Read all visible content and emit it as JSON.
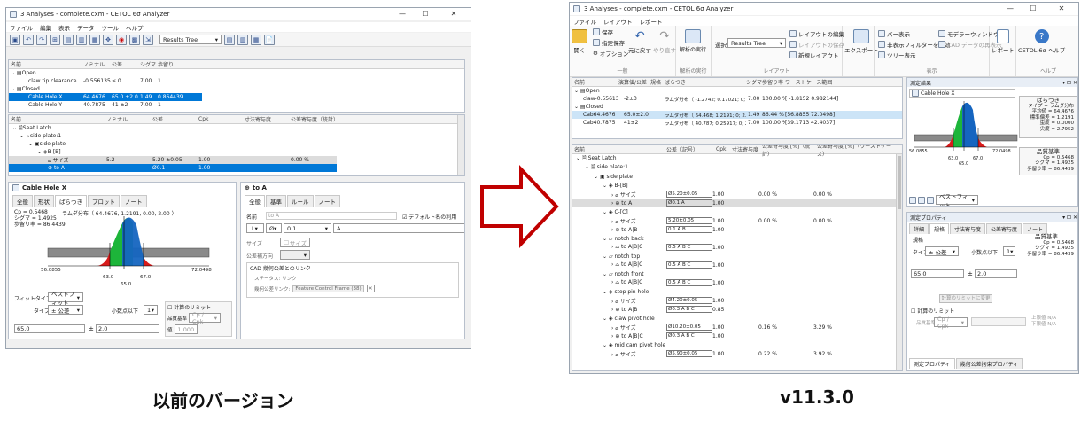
{
  "arrow_color": "#c00000",
  "old": {
    "window_title": "3 Analyses - complete.cxm - CETOL 6σ Analyzer",
    "menu": [
      "ファイル",
      "編集",
      "表示",
      "データ",
      "ツール",
      "ヘルプ"
    ],
    "toolbar_select": "Results Tree",
    "analysis_header": [
      "名前",
      "ノミナル",
      "公差",
      "シグマ",
      "歩留り"
    ],
    "analyses": {
      "open": "Open",
      "open_child": {
        "name": "claw tip clearance",
        "nominal": "-0.556135",
        "tol": "≤ 0",
        "sigma": "7.00",
        "yield": "1"
      },
      "closed": "Closed",
      "rows": [
        {
          "name": "Cable Hole X",
          "nominal": "64.4676",
          "tol": "65.0 ±2.0",
          "sigma": "1.49",
          "yield": "0.864439"
        },
        {
          "name": "Cable Hole Y",
          "nominal": "40.7875",
          "tol": "41 ±2",
          "sigma": "7.00",
          "yield": "1"
        }
      ]
    },
    "tree_header": [
      "名前",
      "ノミナル",
      "公差",
      "Cpk",
      "寸法寄与度",
      "公差寄与度（統計）"
    ],
    "tree": {
      "root": "Seat Latch",
      "n1": "side plate:1",
      "n2": "side plate",
      "n3": "B-[B]",
      "size": {
        "label": "サイズ",
        "nominal": "5.2",
        "tol": "5.20 ±0.05",
        "cpk": "1.00",
        "contrib": "0.00 %"
      },
      "toA": {
        "label": "to A",
        "tol": "Ø0.1",
        "cpk": "1.00"
      }
    },
    "detail_title": "Cable Hole X",
    "detail_tabs": [
      "全般",
      "形状",
      "ばらつき",
      "プロット",
      "ノート"
    ],
    "dist_label": "ラムダ分布（ 64.4676, 1.2191, 0.00, 2.00 ）",
    "stats": [
      "Cp = 0.5468",
      "シグマ = 1.4925",
      "歩留り率 = 86.4439"
    ],
    "axis": {
      "lo": "56.0855",
      "lsl": "63.0",
      "nom": "65.0",
      "usl": "67.0",
      "hi": "72.0498"
    },
    "fit_type_label": "フィットタイプ",
    "fit_type": "ベストフィット",
    "type_label": "タイプ",
    "type_value": "± 公差",
    "decimals_label": "小数点以下",
    "decimals": "1",
    "nominal_value": "65.0",
    "pm": "±",
    "tol_value": "2.0",
    "calc_limit": "計算のリミット",
    "quality_label": "品質基準",
    "quality_value": "Cp / Cpk",
    "value_label": "値",
    "value_value": "1.000",
    "right_title": "to A",
    "right_tabs": [
      "全般",
      "基準",
      "ルール",
      "ノート"
    ],
    "name_label": "名前",
    "name_value": "to A",
    "default_name": "デフォルト名の利用",
    "fcf_value": "0.1",
    "fcf_datum": "A",
    "size_label": "サイズ",
    "size_btn": "サイズ",
    "tol_dir_label": "公差補方向",
    "cad_group": "CAD 幾何公差とのリンク",
    "status": "ステータス: リンク",
    "geo_link_label": "幾何公差リンク:",
    "geo_link_value": "Feature Control Frame (38)"
  },
  "new": {
    "window_title": "3 Analyses - complete.cxm - CETOL 6σ Analyzer",
    "menu": [
      "ファイル",
      "レイアウト",
      "レポート"
    ],
    "ribbon": {
      "open": "開く",
      "save": "保存",
      "save_as": "指定保存",
      "options": "オプション",
      "undo": "元に戻す",
      "redo": "やり直す",
      "general": "一般",
      "run": "解析の実行",
      "run_group": "解析の実行",
      "select_label": "選択",
      "select_value": "Results Tree",
      "layout_edit": "レイアウトの編集",
      "layout_save": "レイアウトの保存",
      "layout_new": "新規レイアウト",
      "layout_group": "レイアウト",
      "export": "エクスポート",
      "bar_show": "バー表示",
      "hide_filter": "非表示フィルターを無効",
      "tree_show": "ツリー表示",
      "model_win": "モデラーウィンドウ",
      "cad_show": "CAD データの再表示",
      "view_group": "表示",
      "report": "レポート",
      "help": "CETOL 6σ ヘルプ",
      "help_group": "ヘルプ"
    },
    "analysis_header": [
      "名前",
      "演算値/公差",
      "規格",
      "ばらつき",
      "シグマ",
      "歩留り率",
      "ワーストケース範囲"
    ],
    "analyses": {
      "open": "Open",
      "open_child": {
        "name": "claw-0.556135",
        "tol": "-2±3",
        "dist": "ラムダ分布（ -1.2742; 0.17021; 0; 2.86 ）",
        "sigma": "7.00",
        "yield": "100.00 %",
        "wc": "[ -1.8152  0.982144]"
      },
      "closed": "Closed",
      "rows": [
        {
          "name": "Cab64.4676",
          "tol": "65.0±2.0",
          "dist": "ラムダ分布（ 64.468; 1.2191; 0; 2.8 ）",
          "sigma": "1.49",
          "yield": "86.44 %",
          "wc": "[56.8855  72.0498]"
        },
        {
          "name": "Cab40.7875",
          "tol": "41±2",
          "dist": "ラムダ分布（ 40.787; 0.25917; 0; 2.77 ）",
          "sigma": "7.00",
          "yield": "100.00 %",
          "wc": "[39.1713  42.4037]"
        }
      ]
    },
    "tree_header": [
      "名前",
      "公差（記号）",
      "Cpk",
      "寸法寄与度",
      "公差寄与度 [%]（統計）",
      "公差寄与度 [%]（ワーストケース）"
    ],
    "tree": [
      {
        "lvl": 0,
        "label": "Seat Latch",
        "kind": "asm"
      },
      {
        "lvl": 1,
        "label": "side plate:1",
        "kind": "asm"
      },
      {
        "lvl": 2,
        "label": "side plate",
        "kind": "part"
      },
      {
        "lvl": 3,
        "label": "B-[B]",
        "kind": "feat"
      },
      {
        "lvl": 4,
        "label": "サイズ",
        "kind": "size",
        "tol": "Ø5.20±0.05",
        "cpk": "1.00",
        "c1": "0.00 %",
        "c2": "0.00 %"
      },
      {
        "lvl": 4,
        "label": "to A",
        "kind": "pos",
        "tol": "Ø0.1 A",
        "cpk": "1.00",
        "hl": true
      },
      {
        "lvl": 3,
        "label": "C-[C]",
        "kind": "feat"
      },
      {
        "lvl": 4,
        "label": "サイズ",
        "kind": "size",
        "tol": "5.20±0.05",
        "cpk": "1.00",
        "c1": "0.00 %",
        "c2": "0.00 %"
      },
      {
        "lvl": 4,
        "label": "to A|B",
        "kind": "pos",
        "tol": "0.1 A B",
        "cpk": "1.00"
      },
      {
        "lvl": 3,
        "label": "notch back",
        "kind": "feat2"
      },
      {
        "lvl": 4,
        "label": "to A|B|C",
        "kind": "prof",
        "tol": "0.5 A B C",
        "cpk": "1.00"
      },
      {
        "lvl": 3,
        "label": "notch top",
        "kind": "feat2"
      },
      {
        "lvl": 4,
        "label": "to A|B|C",
        "kind": "prof",
        "tol": "0.5 A B C",
        "cpk": "1.00"
      },
      {
        "lvl": 3,
        "label": "notch front",
        "kind": "feat2"
      },
      {
        "lvl": 4,
        "label": "to A|B|C",
        "kind": "prof",
        "tol": "0.5 A B C",
        "cpk": "1.00"
      },
      {
        "lvl": 3,
        "label": "stop pin hole",
        "kind": "feat"
      },
      {
        "lvl": 4,
        "label": "サイズ",
        "kind": "size",
        "tol": "Ø4.20±0.05",
        "cpk": "1.00"
      },
      {
        "lvl": 4,
        "label": "to A|B",
        "kind": "pos",
        "tol": "Ø0.3 A B C",
        "cpk": "0.85"
      },
      {
        "lvl": 3,
        "label": "claw pivot hole",
        "kind": "feat"
      },
      {
        "lvl": 4,
        "label": "サイズ",
        "kind": "size",
        "tol": "Ø10.20±0.05",
        "cpk": "1.00",
        "c1": "0.16 %",
        "c2": "3.29 %"
      },
      {
        "lvl": 4,
        "label": "to A|B|C",
        "kind": "pos",
        "tol": "Ø0.3 A B C",
        "cpk": "1.00"
      },
      {
        "lvl": 3,
        "label": "mid cam pivot hole",
        "kind": "feat"
      },
      {
        "lvl": 4,
        "label": "サイズ",
        "kind": "size",
        "tol": "Ø5.90±0.05",
        "cpk": "1.00",
        "c1": "0.22 %",
        "c2": "3.92 %"
      }
    ],
    "meas_title": "測定結果",
    "meas_name": "Cable Hole X",
    "var_title": "ばらつき",
    "var_lines": [
      "タイプ = ラムダ分布",
      "平均値 = 64.4676",
      "標準偏差 = 1.2191",
      "歪度 = 0.0000",
      "尖度 = 2.7952"
    ],
    "qual_title": "品質基準",
    "qual_lines": [
      "Cp = 0.5468",
      "シグマ = 1.4925",
      "歩留り率 = 86.4439"
    ],
    "axis": {
      "lo": "56.0855",
      "lsl": "63.0",
      "nom": "65.0",
      "usl": "67.0",
      "hi": "72.0498"
    },
    "fit_value": "ベストフィット",
    "prop_title": "測定プロパティ",
    "prop_tabs": [
      "詳細",
      "規格",
      "寸法寄与度",
      "公差寄与度",
      "ノート"
    ],
    "spec_label": "規格",
    "type_label": "タイプ",
    "type_value": "± 公差",
    "decimals_label": "小数点以下",
    "decimals": "1",
    "q_title": "品質基準",
    "q_lines": [
      "Cp = 0.5468",
      "シグマ = 1.4925",
      "歩留り率 = 86.4439"
    ],
    "nominal_value": "65.0",
    "pm": "±",
    "tol_value": "2.0",
    "limit_btn": "計算のリミットに変更",
    "calc_limit": "計算のリミット",
    "std_label": "品質基準",
    "std_value": "Cp / Cpk",
    "upper": "上限値 N/A",
    "lower": "下限値 N/A",
    "bottom_tabs": [
      "測定プロパティ",
      "幾何公差拘束プロパティ"
    ]
  },
  "caption_old": "以前のバージョン",
  "caption_new": "v11.3.0"
}
